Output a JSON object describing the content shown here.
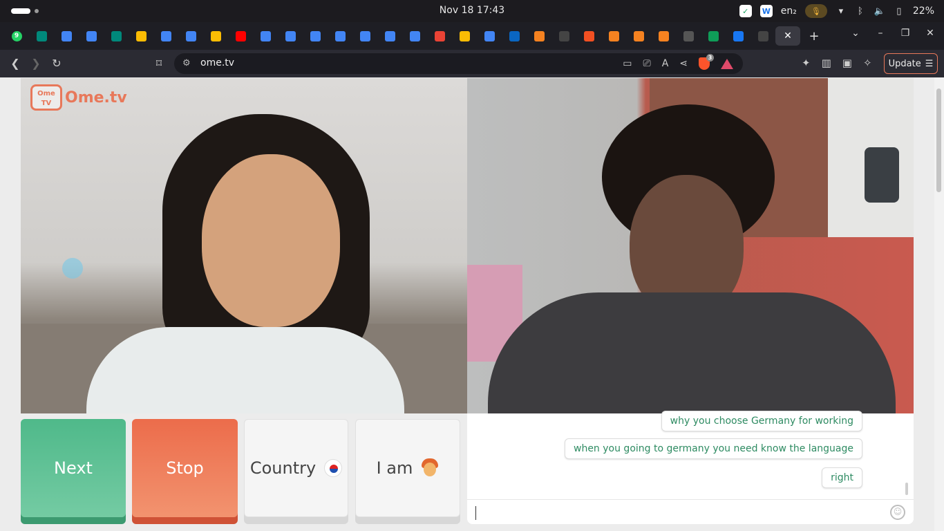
{
  "system_bar": {
    "clock": "Nov 18  17:43",
    "keyboard": "en₂",
    "battery": "22%"
  },
  "tabs": [
    {
      "icon": "whatsapp-icon",
      "badge": "9",
      "color": "#25d366"
    },
    {
      "icon": "meet-icon",
      "color": "#00897b"
    },
    {
      "icon": "docs-icon",
      "color": "#4285f4"
    },
    {
      "icon": "docs-icon",
      "color": "#4285f4"
    },
    {
      "icon": "meet-icon",
      "color": "#00897b"
    },
    {
      "icon": "drive-icon",
      "color": "#fbbc04"
    },
    {
      "icon": "docs-icon",
      "color": "#4285f4"
    },
    {
      "icon": "docs-icon",
      "color": "#4285f4"
    },
    {
      "icon": "drive-icon",
      "color": "#fbbc04"
    },
    {
      "icon": "youtube-icon",
      "color": "#ff0000"
    },
    {
      "icon": "docs-icon",
      "color": "#4285f4"
    },
    {
      "icon": "docs-icon",
      "color": "#4285f4"
    },
    {
      "icon": "docs-icon",
      "color": "#4285f4"
    },
    {
      "icon": "docs-icon",
      "color": "#4285f4"
    },
    {
      "icon": "docs-icon",
      "color": "#4285f4"
    },
    {
      "icon": "docs-icon",
      "color": "#4285f4"
    },
    {
      "icon": "docs-icon",
      "color": "#4285f4"
    },
    {
      "icon": "gmail-icon",
      "color": "#ea4335"
    },
    {
      "icon": "drive-icon",
      "color": "#fbbc04"
    },
    {
      "icon": "docs-icon",
      "color": "#4285f4"
    },
    {
      "icon": "linkedin-icon",
      "color": "#0a66c2"
    },
    {
      "icon": "cube-icon",
      "color": "#f58220"
    },
    {
      "icon": "w-icon",
      "color": "#444444"
    },
    {
      "icon": "chart-icon",
      "color": "#f25022"
    },
    {
      "icon": "cube-icon",
      "color": "#f58220"
    },
    {
      "icon": "cube-icon",
      "color": "#f58220"
    },
    {
      "icon": "cube-icon",
      "color": "#f58220"
    },
    {
      "icon": "openai-icon",
      "color": "#555555"
    },
    {
      "icon": "sheets-icon",
      "color": "#0f9d58"
    },
    {
      "icon": "facebook-icon",
      "color": "#1877f2"
    },
    {
      "icon": "notion-icon",
      "color": "#444444"
    },
    {
      "icon": "close-icon",
      "color": "#3a3a42",
      "active": true
    }
  ],
  "toolbar": {
    "url": "ome.tv",
    "update_label": "Update"
  },
  "logo": {
    "tv_text": "Ome\nTV",
    "wordmark": "Ome.tv"
  },
  "buttons": {
    "next": "Next",
    "stop": "Stop",
    "country": "Country",
    "iam": "I am"
  },
  "chat": {
    "messages": [
      "why you choose Germany for working",
      "when you going to germany you need know the language",
      "right"
    ],
    "input_value": ""
  },
  "colors": {
    "accent_green": "#4fb98a",
    "accent_orange": "#ec6c4b",
    "message_text": "#2e8b62"
  }
}
